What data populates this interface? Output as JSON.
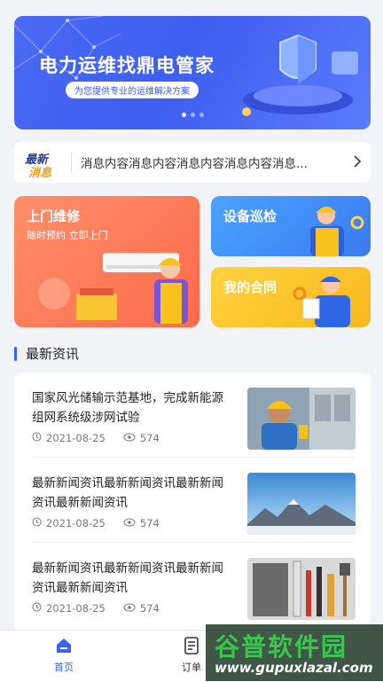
{
  "banner": {
    "title": "电力运维找鼎电管家",
    "subtitle": "为您提供专业的运维解决方案",
    "page_count": 3,
    "active_page": 1,
    "colors": {
      "bg": "#4a6bf5",
      "accent": "#3b5be8"
    }
  },
  "notice": {
    "logo_top": "最新",
    "logo_bottom": "消息",
    "text": "消息内容消息内容消息内容消息内容消息...",
    "arrow_icon": "chevron-right-icon"
  },
  "services": [
    {
      "title": "上门维修",
      "subtitle": "随时预约 立即上门"
    },
    {
      "title": "设备巡检"
    },
    {
      "title": "我的合同"
    }
  ],
  "news_section": {
    "title": "最新资讯"
  },
  "news": [
    {
      "title": "国家风光储输示范基地，完成新能源组网系统级涉网试验",
      "date": "2021-08-25",
      "views": "574",
      "image": "worker-photo"
    },
    {
      "title": "最新新闻资讯最新新闻资讯最新新闻资讯最新新闻资讯",
      "date": "2021-08-25",
      "views": "574",
      "image": "mountain-photo"
    },
    {
      "title": "最新新闻资讯最新新闻资讯最新新闻资讯最新新闻资讯",
      "date": "2021-08-25",
      "views": "574",
      "image": "tools-photo"
    }
  ],
  "tabbar": [
    {
      "label": "首页",
      "icon": "home-icon",
      "active": true
    },
    {
      "label": "订单",
      "icon": "order-icon",
      "active": false
    }
  ],
  "watermark": {
    "line1": "谷普软件园",
    "line2": "www.gupuxlazal.com"
  }
}
